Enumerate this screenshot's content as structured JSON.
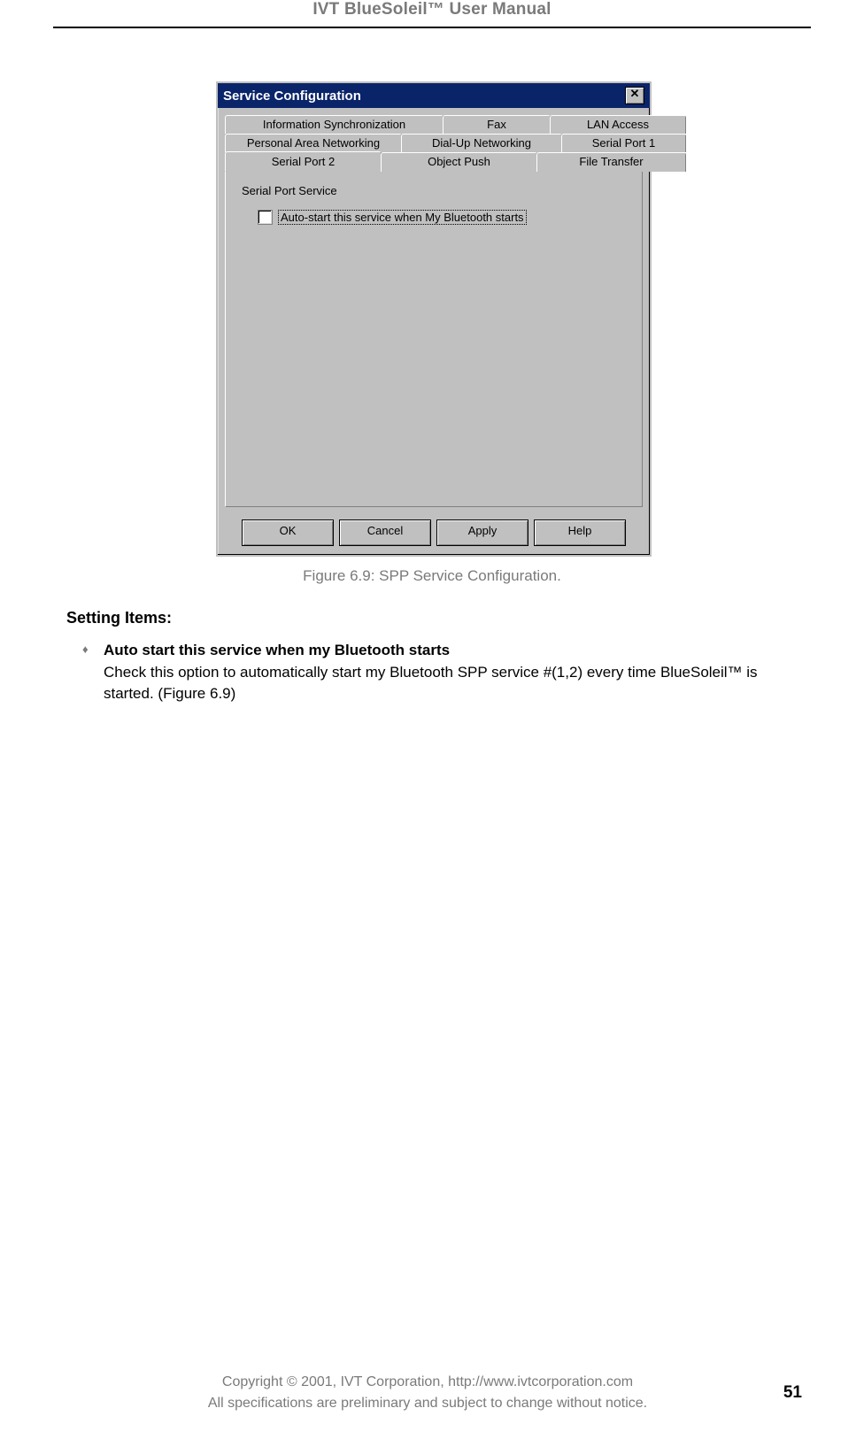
{
  "header": {
    "title": "IVT BlueSoleil™ User Manual"
  },
  "dialog": {
    "title": "Service Configuration",
    "close_label": "×",
    "tabs": {
      "row1": [
        "Information Synchronization",
        "Fax",
        "LAN Access"
      ],
      "row2": [
        "Personal Area Networking",
        "Dial-Up Networking",
        "Serial Port 1"
      ],
      "row3": [
        "Serial Port 2",
        "Object Push",
        "File Transfer"
      ],
      "active": "Serial Port 2"
    },
    "group_label": "Serial Port Service",
    "checkbox_label": "Auto-start this service when My Bluetooth starts",
    "buttons": {
      "ok": "OK",
      "cancel": "Cancel",
      "apply": "Apply",
      "help": "Help"
    }
  },
  "caption": "Figure 6.9: SPP Service Configuration.",
  "section": {
    "heading": "Setting Items:",
    "item_title": "Auto start this service when my Bluetooth starts",
    "item_body": "Check this option to automatically start my Bluetooth SPP service #(1,2) every time BlueSoleil™ is started. (Figure 6.9)"
  },
  "footer": {
    "line1": "Copyright © 2001, IVT Corporation, http://www.ivtcorporation.com",
    "line2": "All specifications are preliminary and subject to change without notice.",
    "page_number": "51"
  }
}
